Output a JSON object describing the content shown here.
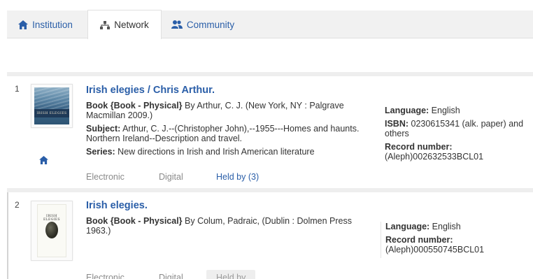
{
  "tabs": [
    {
      "label": "Institution",
      "icon": "home-icon",
      "active": false
    },
    {
      "label": "Network",
      "icon": "network-icon",
      "active": true
    },
    {
      "label": "Community",
      "icon": "users-icon",
      "active": false
    }
  ],
  "colors": {
    "link": "#2a5ea8",
    "muted": "#8a8a8a",
    "tab_bg": "#f1f1f1",
    "separator": "#eeeeee"
  },
  "results": [
    {
      "number": "1",
      "cover_title": "IRISH ELEGIES",
      "title": "Irish elegies / Chris Arthur.",
      "format_label": "Book {Book - Physical}",
      "format_text": " By Arthur, C. J. (New York, NY : Palgrave Macmillan 2009.)",
      "subject_label": "Subject:",
      "subject_text": " Arthur, C. J.--(Christopher John),--1955---Homes and haunts. Northern Ireland--Description and travel.",
      "series_label": "Series:",
      "series_text": " New directions in Irish and Irish American literature",
      "language_label": "Language:",
      "language": " English",
      "isbn_label": "ISBN:",
      "isbn": " 0230615341 (alk. paper) and others",
      "record_label": "Record number:",
      "record": "(Aleph)002632533BCL01",
      "home_icon": "home-icon",
      "actions": {
        "electronic": "Electronic",
        "digital": "Digital",
        "held": "Held by (3)"
      }
    },
    {
      "number": "2",
      "cover_title": "IRISH ELEGIES",
      "title": "Irish elegies.",
      "format_label": "Book {Book - Physical}",
      "format_text": " By Colum, Padraic, (Dublin : Dolmen Press 1963.)",
      "language_label": "Language:",
      "language": " English",
      "record_label": "Record number:",
      "record": "(Aleph)000550745BCL01",
      "actions": {
        "electronic": "Electronic",
        "digital": "Digital",
        "held": "Held by"
      }
    }
  ]
}
